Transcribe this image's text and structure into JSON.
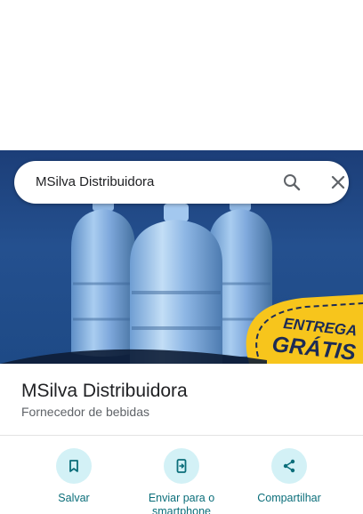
{
  "search": {
    "query": "MSilva Distribuidora"
  },
  "hero": {
    "badge_line1": "ENTREGA",
    "badge_line2": "GRÁTIS"
  },
  "place": {
    "name": "MSilva Distribuidora",
    "category": "Fornecedor de bebidas"
  },
  "actions": [
    {
      "label": "Salvar",
      "icon": "bookmark-icon"
    },
    {
      "label": "Enviar para o smartphone",
      "icon": "send-to-phone-icon"
    },
    {
      "label": "Compartilhar",
      "icon": "share-icon"
    }
  ],
  "colors": {
    "accent": "#0b6e7a",
    "action_bg": "#d3f1f6",
    "badge": "#f7c51c",
    "hero_bg": "#1f4a88"
  }
}
